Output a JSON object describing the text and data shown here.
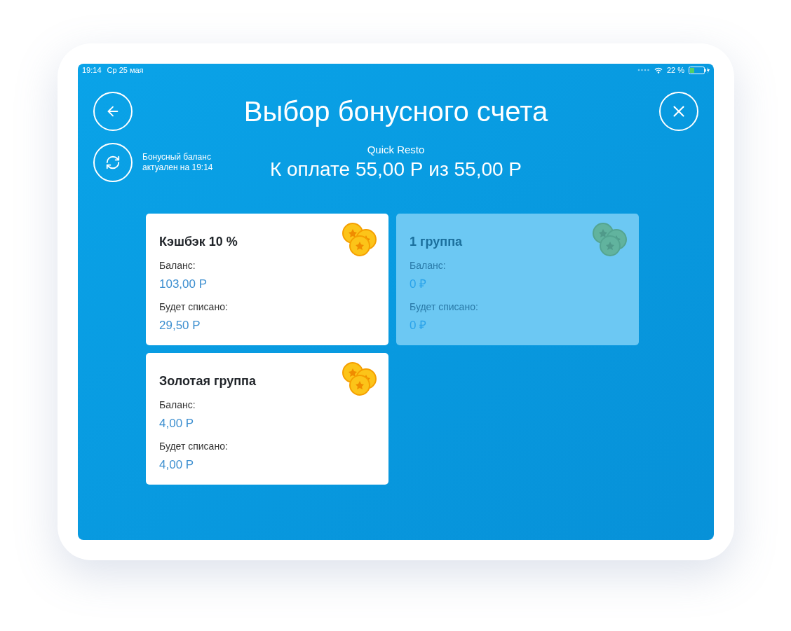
{
  "status_bar": {
    "time": "19:14",
    "date": "Ср 25 мая",
    "battery": "22 %"
  },
  "header": {
    "title": "Выбор бонусного счета",
    "refresh_note": "Бонусный баланс\nактуален на 19:14",
    "venue": "Quick Resto",
    "amount": "К оплате 55,00 Р из 55,00 Р"
  },
  "accounts": [
    {
      "name": "Кэшбэк 10 %",
      "disabled": false,
      "balance_label": "Баланс:",
      "balance": "103,00 Р",
      "charge_label": "Будет списано:",
      "charge": "29,50 Р"
    },
    {
      "name": "1 группа",
      "disabled": true,
      "balance_label": "Баланс:",
      "balance": "0 ₽",
      "charge_label": "Будет списано:",
      "charge": "0 ₽"
    },
    {
      "name": "Золотая группа",
      "disabled": false,
      "balance_label": "Баланс:",
      "balance": "4,00 Р",
      "charge_label": "Будет списано:",
      "charge": "4,00 Р"
    }
  ]
}
